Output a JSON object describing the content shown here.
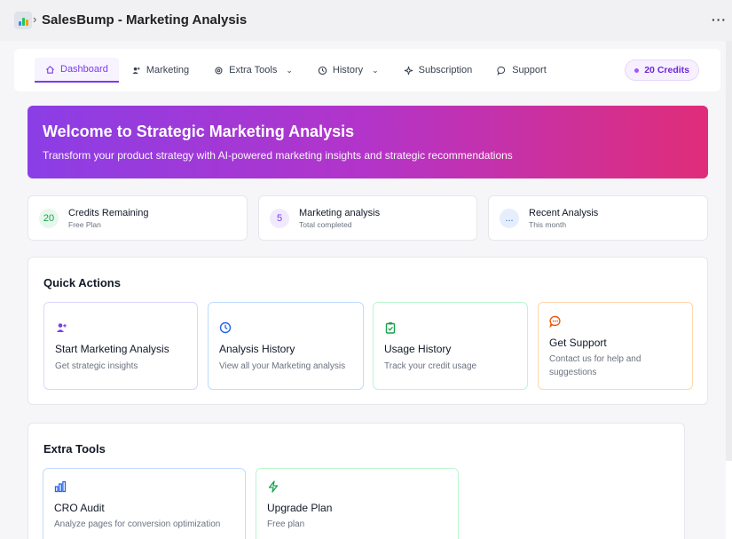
{
  "window": {
    "title": "SalesBump - Marketing Analysis",
    "separator": "›",
    "more": "···"
  },
  "nav": {
    "items": [
      {
        "label": "Dashboard",
        "icon": "home-icon",
        "active": true
      },
      {
        "label": "Marketing",
        "icon": "user-plus-icon"
      },
      {
        "label": "Extra Tools",
        "icon": "gear-icon",
        "dropdown": true
      },
      {
        "label": "History",
        "icon": "clock-icon",
        "dropdown": true
      },
      {
        "label": "Subscription",
        "icon": "sparkle-icon"
      },
      {
        "label": "Support",
        "icon": "chat-icon"
      }
    ],
    "credits_label": "20 Credits"
  },
  "hero": {
    "title": "Welcome to Strategic Marketing Analysis",
    "subtitle": "Transform your product strategy with AI-powered marketing insights and strategic recommendations"
  },
  "stats": [
    {
      "value": "20",
      "title": "Credits Remaining",
      "sub": "Free Plan",
      "color": "#16a34a",
      "bg": "#e7f7ec"
    },
    {
      "value": "5",
      "title": "Marketing analysis",
      "sub": "Total completed",
      "color": "#7c3aed",
      "bg": "#f1eafe"
    },
    {
      "value": "...",
      "title": "Recent Analysis",
      "sub": "This month",
      "color": "#2563eb",
      "bg": "#e6eefc"
    }
  ],
  "quick_actions": {
    "heading": "Quick Actions",
    "cards": [
      {
        "title": "Start Marketing Analysis",
        "sub": "Get strategic insights",
        "icon": "user-plus-icon",
        "accent": "#7c3aed"
      },
      {
        "title": "Analysis History",
        "sub": "View all your Marketing analysis",
        "icon": "clock-icon",
        "accent": "#2563eb"
      },
      {
        "title": "Usage History",
        "sub": "Track your credit usage",
        "icon": "clipboard-check-icon",
        "accent": "#16a34a"
      },
      {
        "title": "Get Support",
        "sub": "Contact us for help and suggestions",
        "icon": "chat-icon",
        "accent": "#ea580c"
      }
    ]
  },
  "extra_tools": {
    "heading": "Extra Tools",
    "cards": [
      {
        "title": "CRO Audit",
        "sub": "Analyze pages for conversion optimization",
        "icon": "bar-chart-icon",
        "accent": "#2563eb"
      },
      {
        "title": "Upgrade Plan",
        "sub": "Free plan",
        "icon": "bolt-icon",
        "accent": "#16a34a"
      }
    ]
  }
}
